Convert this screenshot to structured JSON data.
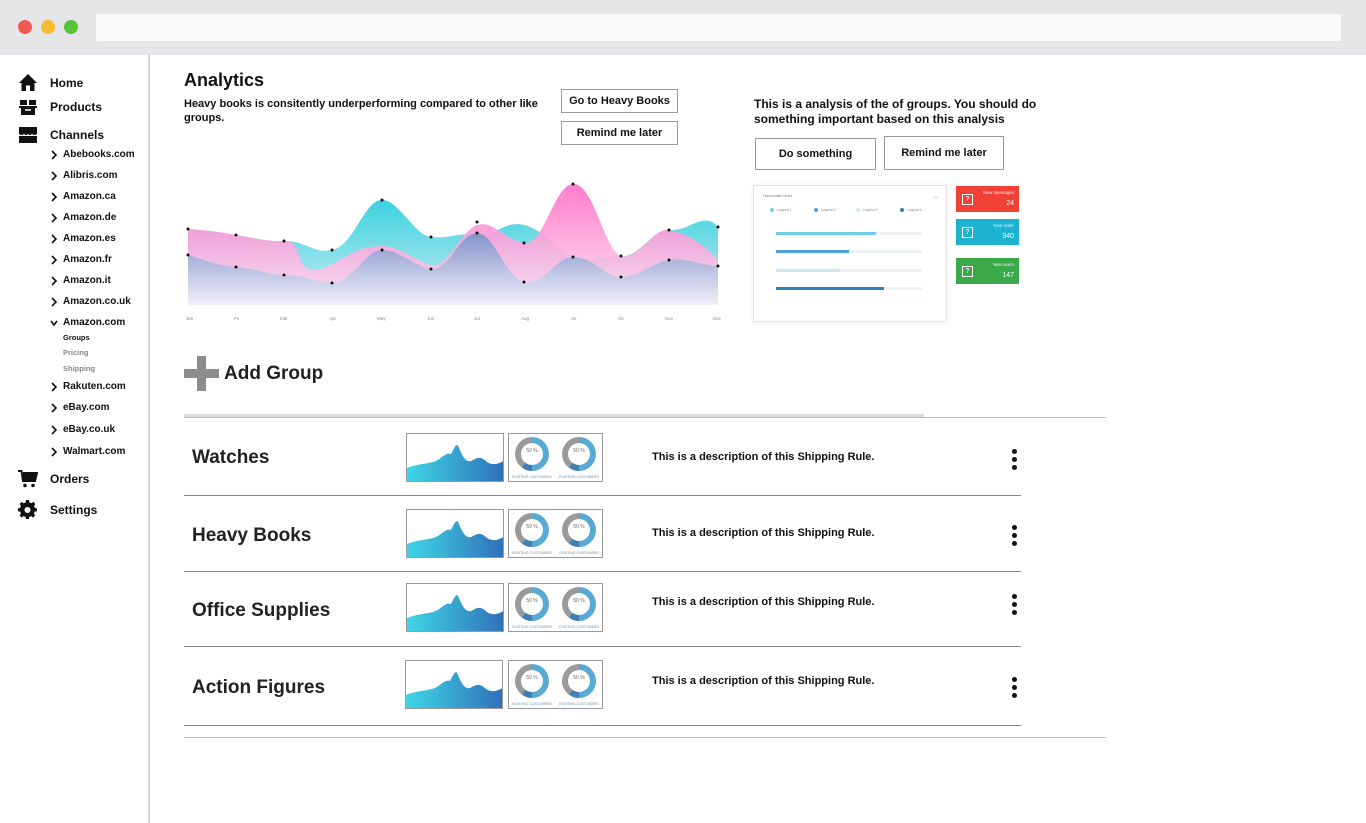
{
  "sidebar": {
    "home": "Home",
    "products": "Products",
    "channels": "Channels",
    "channel_items": [
      "Abebooks.com",
      "Alibris.com",
      "Amazon.ca",
      "Amazon.de",
      "Amazon.es",
      "Amazon.fr",
      "Amazon.it",
      "Amazon.co.uk",
      "Amazon.com"
    ],
    "amazon_com_sub": [
      "Groups",
      "Pricing",
      "Shipping"
    ],
    "channel_items_2": [
      "Rakuten.com",
      "eBay.com",
      "eBay.co.uk",
      "Walmart.com"
    ],
    "orders": "Orders",
    "settings": "Settings"
  },
  "main": {
    "title": "Analytics",
    "insight1": "Heavy books is consitently underperforming compared to other like groups.",
    "go_heavy_books": "Go to Heavy Books",
    "remind_later_1": "Remind me later",
    "insight2": "This is a analysis of the of groups. You should do something important based on this analysis",
    "do_something": "Do something",
    "remind_later_2": "Remind me later",
    "add_group": "Add Group"
  },
  "area_chart": {
    "months": [
      "Jan",
      "Fe",
      "Mar",
      "Apr",
      "May",
      "Jun",
      "Jul",
      "Aug",
      "Se",
      "Oc",
      "Nov",
      "Dec"
    ],
    "colors": {
      "teal": "#49cfdc",
      "pink": "#f87bc8",
      "blue": "#6a8fc8"
    }
  },
  "horizontal_chart": {
    "title": "Horizontal Chart",
    "legend": [
      "Legend 1",
      "Legend 2",
      "Legend 3",
      "Legend 4"
    ]
  },
  "stats": [
    {
      "label": "New messages",
      "value": "24",
      "color": "#ef4136"
    },
    {
      "label": "New order",
      "value": "340",
      "color": "#1cb3d0"
    },
    {
      "label": "New users",
      "value": "147",
      "color": "#3aa94a"
    }
  ],
  "groups": [
    {
      "name": "Watches",
      "description": "This is a description of this Shipping Rule.",
      "donut1": "50 %",
      "donut2": "50 %",
      "caption": "EXISTING CUSTOMERS"
    },
    {
      "name": "Heavy Books",
      "description": "This is a description of this Shipping Rule.",
      "donut1": "50 %",
      "donut2": "50 %",
      "caption": "EXISTING CUSTOMERS"
    },
    {
      "name": "Office Supplies",
      "description": "This is a description of this Shipping Rule.",
      "donut1": "50 %",
      "donut2": "50 %",
      "caption": "EXISTING CUSTOMERS"
    },
    {
      "name": "Action Figures",
      "description": "This is a description of this Shipping Rule.",
      "donut1": "50 %",
      "donut2": "50 %",
      "caption": "EXISTING CUSTOMERS"
    }
  ]
}
